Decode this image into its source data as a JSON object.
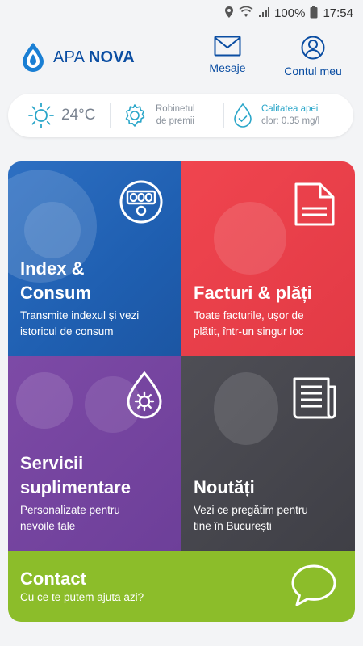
{
  "status": {
    "battery": "100%",
    "time": "17:54"
  },
  "header": {
    "logo_main": "APA",
    "logo_bold": "NOVA",
    "mesaje_label": "Mesaje",
    "cont_label": "Contul meu"
  },
  "info": {
    "temperature": "24°C",
    "robinet_line1": "Robinetul",
    "robinet_line2": "de premii",
    "apa_title": "Calitatea apei",
    "apa_sub": "clor: 0.35 mg/l"
  },
  "tiles": {
    "index": {
      "title1": "Index &",
      "title2": "Consum",
      "sub1": "Transmite indexul și vezi",
      "sub2": "istoricul de consum"
    },
    "facturi": {
      "title1": "Facturi & plăți",
      "sub1": "Toate facturile, ușor de",
      "sub2": "plătit, într-un singur loc"
    },
    "servicii": {
      "title1": "Servicii",
      "title2": "suplimentare",
      "sub1": "Personalizate pentru",
      "sub2": "nevoile tale"
    },
    "noutati": {
      "title1": "Noutăți",
      "sub1": "Vezi ce pregătim pentru",
      "sub2": "tine în București"
    },
    "contact": {
      "title1": "Contact",
      "sub1": "Cu ce te putem ajuta azi?"
    }
  },
  "colors": {
    "brand_blue": "#0a4da2",
    "index_tile": "#1f5fb1",
    "facturi_tile": "#e23a45",
    "servicii_tile": "#6d3f99",
    "noutati_tile": "#3f3f46",
    "contact_tile": "#8cbd2a"
  }
}
